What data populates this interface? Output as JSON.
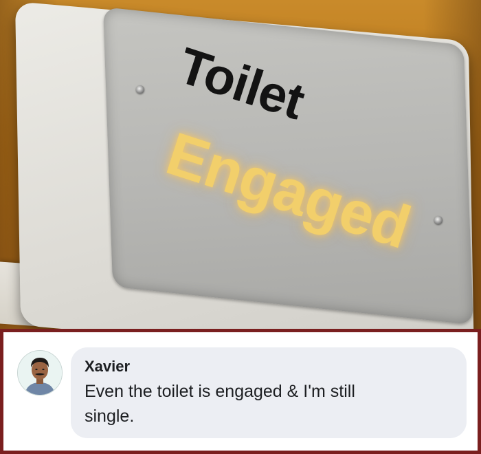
{
  "photo": {
    "sign_line_1": "Toilet",
    "sign_line_2": "Engaged",
    "colors": {
      "wall": "#b8761a",
      "sign_housing": "#e3e1db",
      "sign_face": "#b6b6b3",
      "text_dark": "#131313",
      "text_lit": "#f2cf6b"
    }
  },
  "comment": {
    "author": "Xavier",
    "text": "Even the toilet is engaged & I'm still single.",
    "avatar_icon": "user-avatar-photo",
    "colors": {
      "frame_border": "#7a1f1f",
      "bubble_bg": "#eceef3",
      "text": "#1c1e21"
    }
  }
}
